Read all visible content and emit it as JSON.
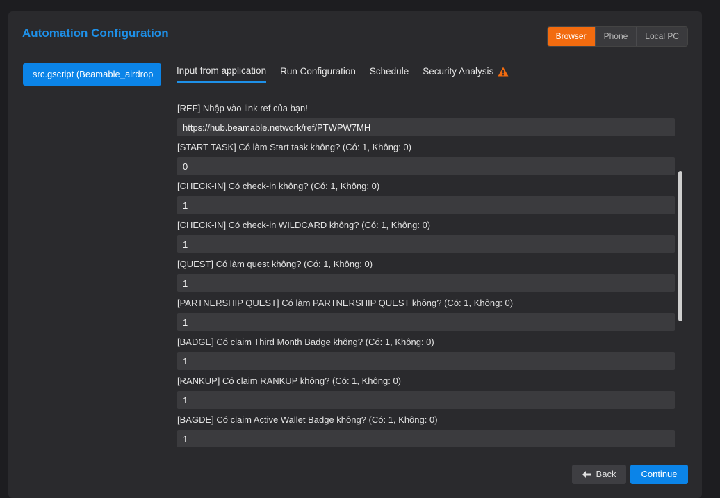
{
  "header": {
    "title": "Automation Configuration"
  },
  "environments": [
    {
      "label": "Browser",
      "active": true
    },
    {
      "label": "Phone",
      "active": false
    },
    {
      "label": "Local PC",
      "active": false
    }
  ],
  "sidebar": {
    "script_label": "src.gscript   (Beamable_airdrop"
  },
  "tabs": [
    {
      "label": "Input from application",
      "active": true
    },
    {
      "label": "Run Configuration"
    },
    {
      "label": "Schedule"
    },
    {
      "label": "Security Analysis",
      "icon": "warning-icon"
    }
  ],
  "colors": {
    "accent": "#1e90e8",
    "active_env": "#f26b0f",
    "warning": "#f26b0f"
  },
  "fields": [
    {
      "label": "[REF] Nhập vào link ref của bạn!",
      "value": "https://hub.beamable.network/ref/PTWPW7MH"
    },
    {
      "label": "[START TASK] Có làm Start task không? (Có: 1, Không: 0)",
      "value": "0"
    },
    {
      "label": "[CHECK-IN] Có check-in không? (Có: 1, Không: 0)",
      "value": "1"
    },
    {
      "label": "[CHECK-IN] Có check-in WILDCARD không? (Có: 1, Không: 0)",
      "value": "1"
    },
    {
      "label": "[QUEST] Có làm quest không? (Có: 1, Không: 0)",
      "value": "1"
    },
    {
      "label": "[PARTNERSHIP QUEST] Có làm PARTNERSHIP QUEST không? (Có: 1, Không: 0)",
      "value": "1"
    },
    {
      "label": "[BADGE] Có claim Third Month Badge không? (Có: 1, Không: 0)",
      "value": "1"
    },
    {
      "label": "[RANKUP] Có claim RANKUP không? (Có: 1, Không: 0)",
      "value": "1"
    },
    {
      "label": "[BAGDE] Có claim Active Wallet Badge không? (Có: 1, Không: 0)",
      "value": "1"
    }
  ],
  "footer": {
    "back_label": "Back",
    "continue_label": "Continue"
  }
}
